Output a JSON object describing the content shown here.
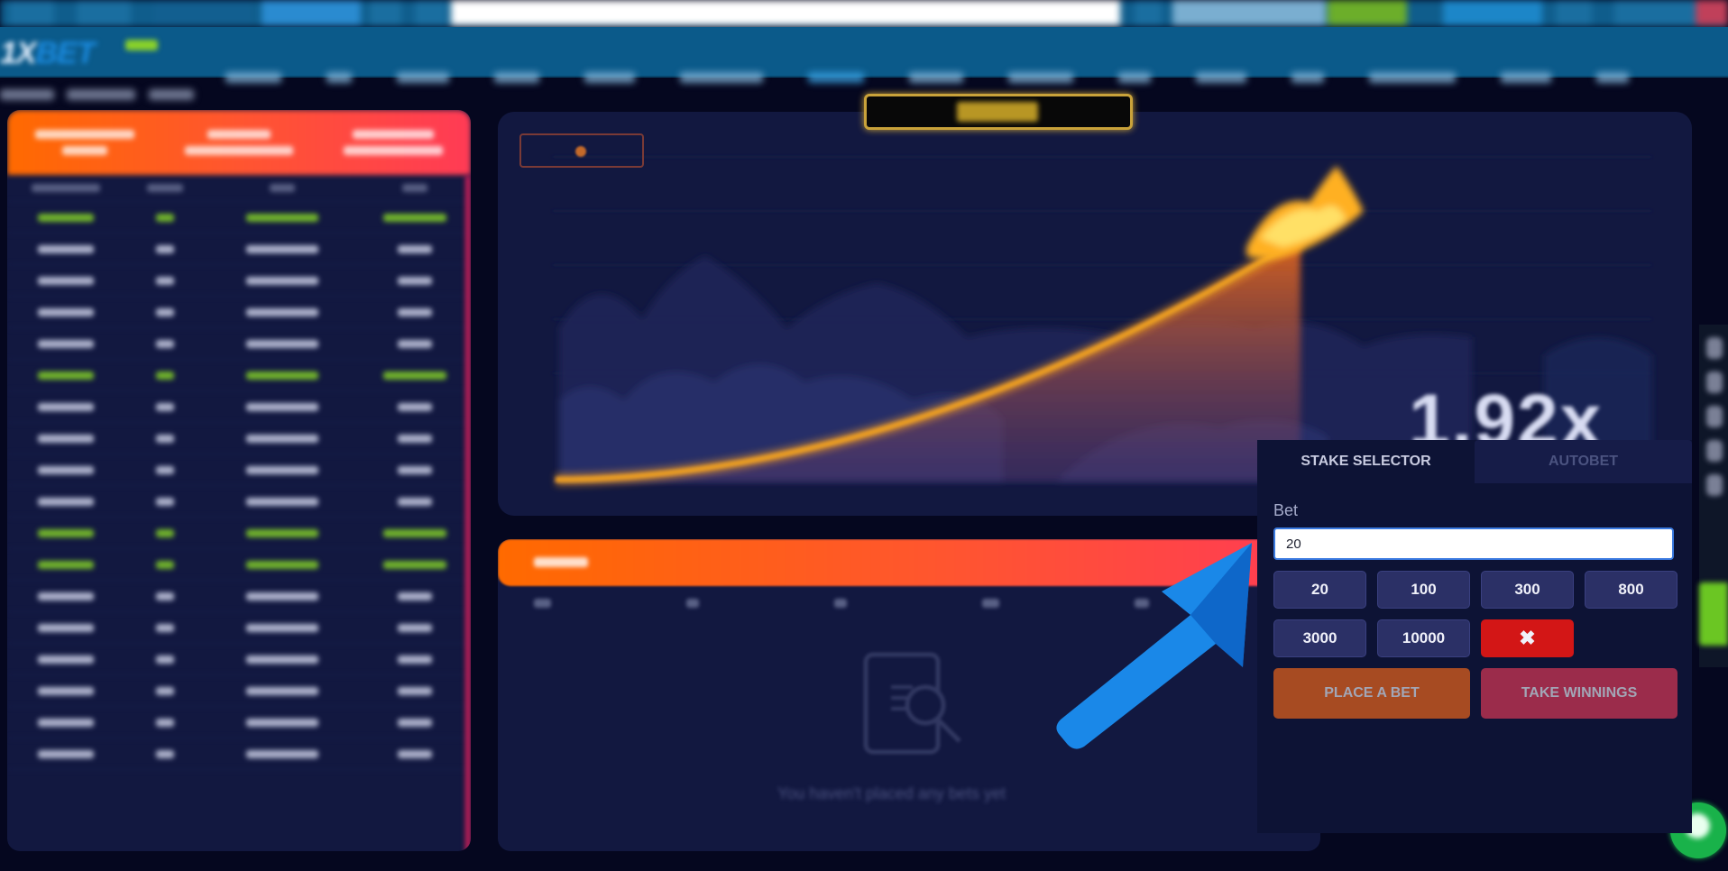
{
  "header": {
    "logo_part1": "1X",
    "logo_part2": "BET"
  },
  "game": {
    "multiplier": "1.92x",
    "colors": {
      "panel_bg": "#121840",
      "accent_gradient_start": "#ff6a00",
      "accent_gradient_end": "#ff3b55",
      "curve": "#f0a020"
    }
  },
  "my_bets": {
    "empty_message": "You haven't placed any bets yet"
  },
  "stake_selector": {
    "tabs": [
      {
        "label": "STAKE SELECTOR",
        "active": true
      },
      {
        "label": "AUTOBET",
        "active": false
      }
    ],
    "bet_label": "Bet",
    "bet_value": "20",
    "quick_amounts": [
      "20",
      "100",
      "300",
      "800",
      "3000",
      "10000"
    ],
    "clear_icon": "✖",
    "place_bet_label": "PLACE A BET",
    "take_winnings_label": "TAKE WINNINGS",
    "colors": {
      "chip_bg": "#2b3066",
      "clear_bg": "#d31616",
      "place_bg": "#a74b22",
      "take_bg": "#9b2c4b"
    }
  },
  "annotation": {
    "arrow_color": "#1a88e8",
    "arrow_target": "bet-input"
  }
}
